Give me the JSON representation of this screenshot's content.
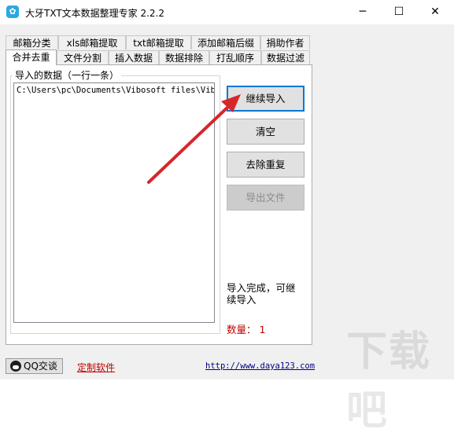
{
  "window": {
    "title": "大牙TXT文本数据整理专家 2.2.2",
    "icon": "tooth-icon",
    "controls": {
      "minimize": "─",
      "maximize": "☐",
      "close": "✕"
    }
  },
  "tabs_row1": [
    "邮箱分类",
    "xls邮箱提取",
    "txt邮箱提取",
    "添加邮箱后缀",
    "捐助作者"
  ],
  "tabs_row2": [
    "合并去重",
    "文件分割",
    "插入数据",
    "数据排除",
    "打乱顺序",
    "数据过滤"
  ],
  "active_tab": "合并去重",
  "import_group": {
    "label": "导入的数据（一行一条）",
    "items": [
      "C:\\Users\\pc\\Documents\\Vibosoft files\\Vibos"
    ]
  },
  "buttons": {
    "continue_import": "继续导入",
    "clear": "清空",
    "dedupe": "去除重复",
    "export": "导出文件"
  },
  "status": {
    "message": "导入完成，可继续导入",
    "count_label": "数量：",
    "count_value": "1"
  },
  "footer": {
    "qq_button": "QQ交谈",
    "custom_link": "定制软件",
    "site_link": "http://www.daya123.com"
  },
  "colors": {
    "accent": "#0078d7",
    "status_red": "#c00000",
    "arrow": "#d7262a"
  }
}
